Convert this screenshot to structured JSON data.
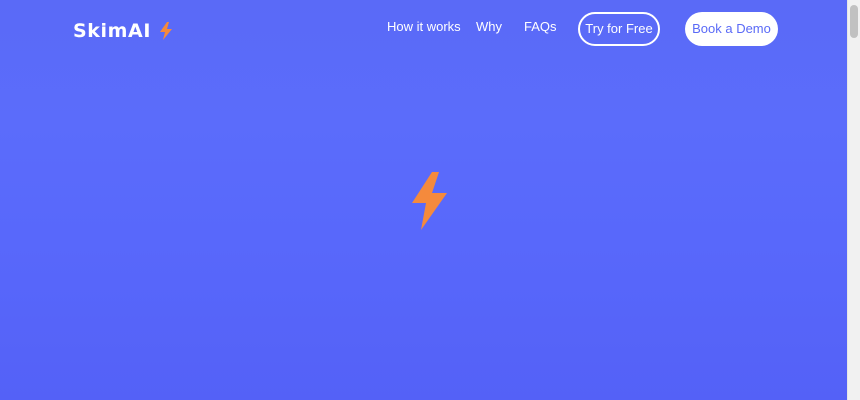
{
  "brand": {
    "name": "SkimAI",
    "icon": "lightning-bolt-icon",
    "accent_color": "#f58a3c"
  },
  "nav": {
    "how_it_works": "How it works",
    "why": "Why",
    "faqs": "FAQs",
    "try_for_free": "Try for Free",
    "book_demo": "Book a Demo"
  },
  "hero": {
    "icon": "lightning-bolt-icon"
  },
  "colors": {
    "background": "#5a6af7",
    "text": "#ffffff"
  }
}
